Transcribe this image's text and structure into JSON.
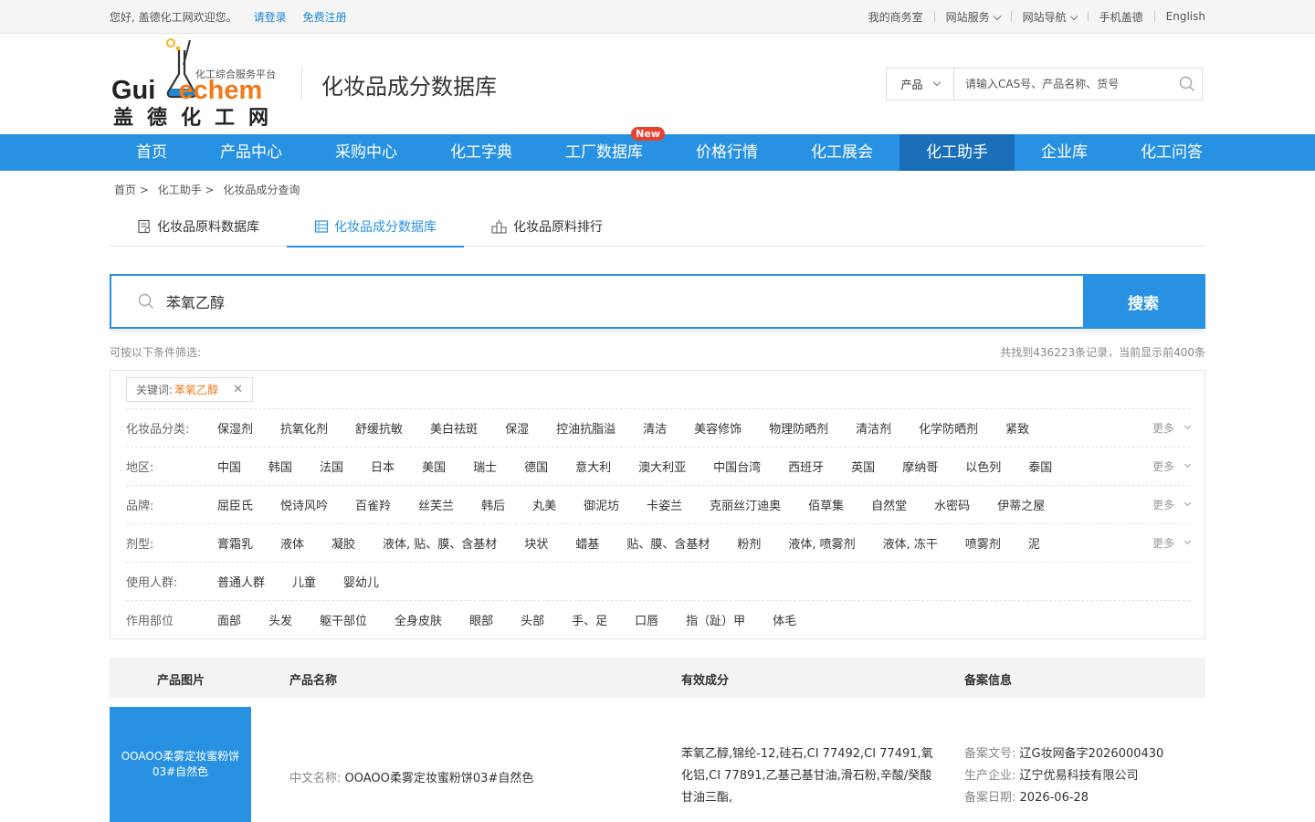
{
  "topbar": {
    "welcome": "您好, 盖德化工网欢迎您。",
    "login": "请登录",
    "register": "免费注册",
    "links": [
      "我的商务室",
      "网站服务",
      "网站导航",
      "手机盖德",
      "English"
    ]
  },
  "header": {
    "logo_slogan": "化工综合服务平台",
    "logo_gui": "Gui",
    "logo_echem": "echem",
    "logo_cn": "盖德化工网",
    "site_title": "化妆品成分数据库",
    "search_category": "产品",
    "search_placeholder": "请输入CAS号、产品名称、货号"
  },
  "nav": {
    "items": [
      "首页",
      "产品中心",
      "采购中心",
      "化工字典",
      "工厂数据库",
      "价格行情",
      "化工展会",
      "化工助手",
      "企业库",
      "化工问答"
    ],
    "badge": "New",
    "active": "化工助手"
  },
  "breadcrumb": [
    "首页 >",
    "化工助手 >",
    "化妆品成分查询"
  ],
  "tabs": [
    "化妆品原料数据库",
    "化妆品成分数据库",
    "化妆品原料排行"
  ],
  "search": {
    "query": "苯氧乙醇",
    "button": "搜索"
  },
  "filter_hint": "可按以下条件筛选:",
  "result_info": "共找到436223条记录，当前显示前400条",
  "keyword_tag": {
    "label": "关键词:",
    "value": "苯氧乙醇"
  },
  "filters": [
    {
      "label": "化妆品分类:",
      "options": [
        "保湿剂",
        "抗氧化剂",
        "舒缓抗敏",
        "美白祛斑",
        "保湿",
        "控油抗脂溢",
        "清洁",
        "美容修饰",
        "物理防晒剂",
        "清洁剂",
        "化学防晒剂",
        "紧致"
      ],
      "more": "更多"
    },
    {
      "label": "地区:",
      "options": [
        "中国",
        "韩国",
        "法国",
        "日本",
        "美国",
        "瑞士",
        "德国",
        "意大利",
        "澳大利亚",
        "中国台湾",
        "西班牙",
        "英国",
        "摩纳哥",
        "以色列",
        "泰国"
      ],
      "more": "更多"
    },
    {
      "label": "品牌:",
      "options": [
        "屈臣氏",
        "悦诗风吟",
        "百雀羚",
        "丝芙兰",
        "韩后",
        "丸美",
        "御泥坊",
        "卡姿兰",
        "克丽丝汀迪奥",
        "佰草集",
        "自然堂",
        "水密码",
        "伊蒂之屋"
      ],
      "more": "更多"
    },
    {
      "label": "剂型:",
      "options": [
        "膏霜乳",
        "液体",
        "凝胶",
        "液体, 贴、膜、含基材",
        "块状",
        "蜡基",
        "贴、膜、含基材",
        "粉剂",
        "液体, 喷雾剂",
        "液体, 冻干",
        "喷雾剂",
        "泥"
      ],
      "more": "更多"
    },
    {
      "label": "使用人群:",
      "options": [
        "普通人群",
        "儿童",
        "婴幼儿"
      ],
      "more": ""
    },
    {
      "label": "作用部位",
      "options": [
        "面部",
        "头发",
        "躯干部位",
        "全身皮肤",
        "眼部",
        "头部",
        "手、足",
        "口唇",
        "指（趾）甲",
        "体毛"
      ],
      "more": ""
    }
  ],
  "table": {
    "headers": [
      "产品图片",
      "产品名称",
      "有效成分",
      "备案信息"
    ],
    "rows": [
      {
        "image_text": "OOAOO柔雾定妆蜜粉饼03#自然色",
        "name_label": "中文名称:",
        "name": "OOAOO柔雾定妆蜜粉饼03#自然色",
        "ingredients": "苯氧乙醇,锦纶-12,硅石,CI 77492,CI 77491,氧化铝,CI 77891,乙基己基甘油,滑石粉,辛酸/癸酸甘油三酯,",
        "record_no_label": "备案文号:",
        "record_no": "辽G妆网备字2026000430",
        "producer_label": "生产企业:",
        "producer": "辽宁优易科技有限公司",
        "date_label": "备案日期:",
        "date": "2026-06-28"
      }
    ]
  },
  "colors": {
    "brand_blue": "#2891e2",
    "nav_active": "#1a6fb8",
    "accent_orange": "#ef7a1a",
    "badge_red": "#e8412c"
  },
  "icons": [
    "flask-logo-icon",
    "search-icon",
    "database-list-icon",
    "database-active-icon",
    "ranking-icon",
    "close-icon",
    "chevron-down-icon"
  ]
}
